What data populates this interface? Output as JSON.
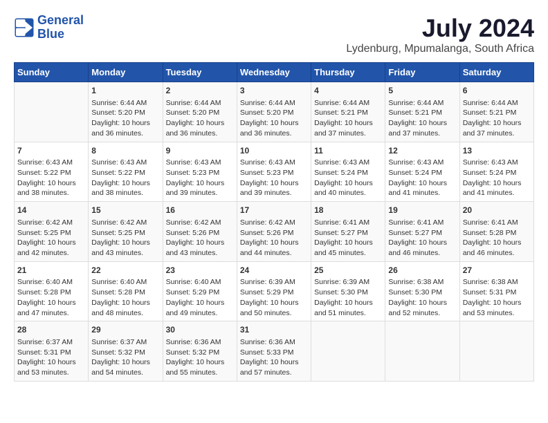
{
  "header": {
    "logo_line1": "General",
    "logo_line2": "Blue",
    "title": "July 2024",
    "subtitle": "Lydenburg, Mpumalanga, South Africa"
  },
  "columns": [
    "Sunday",
    "Monday",
    "Tuesday",
    "Wednesday",
    "Thursday",
    "Friday",
    "Saturday"
  ],
  "weeks": [
    [
      {
        "day": "",
        "info": ""
      },
      {
        "day": "1",
        "info": "Sunrise: 6:44 AM\nSunset: 5:20 PM\nDaylight: 10 hours\nand 36 minutes."
      },
      {
        "day": "2",
        "info": "Sunrise: 6:44 AM\nSunset: 5:20 PM\nDaylight: 10 hours\nand 36 minutes."
      },
      {
        "day": "3",
        "info": "Sunrise: 6:44 AM\nSunset: 5:20 PM\nDaylight: 10 hours\nand 36 minutes."
      },
      {
        "day": "4",
        "info": "Sunrise: 6:44 AM\nSunset: 5:21 PM\nDaylight: 10 hours\nand 37 minutes."
      },
      {
        "day": "5",
        "info": "Sunrise: 6:44 AM\nSunset: 5:21 PM\nDaylight: 10 hours\nand 37 minutes."
      },
      {
        "day": "6",
        "info": "Sunrise: 6:44 AM\nSunset: 5:21 PM\nDaylight: 10 hours\nand 37 minutes."
      }
    ],
    [
      {
        "day": "7",
        "info": "Sunrise: 6:43 AM\nSunset: 5:22 PM\nDaylight: 10 hours\nand 38 minutes."
      },
      {
        "day": "8",
        "info": "Sunrise: 6:43 AM\nSunset: 5:22 PM\nDaylight: 10 hours\nand 38 minutes."
      },
      {
        "day": "9",
        "info": "Sunrise: 6:43 AM\nSunset: 5:23 PM\nDaylight: 10 hours\nand 39 minutes."
      },
      {
        "day": "10",
        "info": "Sunrise: 6:43 AM\nSunset: 5:23 PM\nDaylight: 10 hours\nand 39 minutes."
      },
      {
        "day": "11",
        "info": "Sunrise: 6:43 AM\nSunset: 5:24 PM\nDaylight: 10 hours\nand 40 minutes."
      },
      {
        "day": "12",
        "info": "Sunrise: 6:43 AM\nSunset: 5:24 PM\nDaylight: 10 hours\nand 41 minutes."
      },
      {
        "day": "13",
        "info": "Sunrise: 6:43 AM\nSunset: 5:24 PM\nDaylight: 10 hours\nand 41 minutes."
      }
    ],
    [
      {
        "day": "14",
        "info": "Sunrise: 6:42 AM\nSunset: 5:25 PM\nDaylight: 10 hours\nand 42 minutes."
      },
      {
        "day": "15",
        "info": "Sunrise: 6:42 AM\nSunset: 5:25 PM\nDaylight: 10 hours\nand 43 minutes."
      },
      {
        "day": "16",
        "info": "Sunrise: 6:42 AM\nSunset: 5:26 PM\nDaylight: 10 hours\nand 43 minutes."
      },
      {
        "day": "17",
        "info": "Sunrise: 6:42 AM\nSunset: 5:26 PM\nDaylight: 10 hours\nand 44 minutes."
      },
      {
        "day": "18",
        "info": "Sunrise: 6:41 AM\nSunset: 5:27 PM\nDaylight: 10 hours\nand 45 minutes."
      },
      {
        "day": "19",
        "info": "Sunrise: 6:41 AM\nSunset: 5:27 PM\nDaylight: 10 hours\nand 46 minutes."
      },
      {
        "day": "20",
        "info": "Sunrise: 6:41 AM\nSunset: 5:28 PM\nDaylight: 10 hours\nand 46 minutes."
      }
    ],
    [
      {
        "day": "21",
        "info": "Sunrise: 6:40 AM\nSunset: 5:28 PM\nDaylight: 10 hours\nand 47 minutes."
      },
      {
        "day": "22",
        "info": "Sunrise: 6:40 AM\nSunset: 5:28 PM\nDaylight: 10 hours\nand 48 minutes."
      },
      {
        "day": "23",
        "info": "Sunrise: 6:40 AM\nSunset: 5:29 PM\nDaylight: 10 hours\nand 49 minutes."
      },
      {
        "day": "24",
        "info": "Sunrise: 6:39 AM\nSunset: 5:29 PM\nDaylight: 10 hours\nand 50 minutes."
      },
      {
        "day": "25",
        "info": "Sunrise: 6:39 AM\nSunset: 5:30 PM\nDaylight: 10 hours\nand 51 minutes."
      },
      {
        "day": "26",
        "info": "Sunrise: 6:38 AM\nSunset: 5:30 PM\nDaylight: 10 hours\nand 52 minutes."
      },
      {
        "day": "27",
        "info": "Sunrise: 6:38 AM\nSunset: 5:31 PM\nDaylight: 10 hours\nand 53 minutes."
      }
    ],
    [
      {
        "day": "28",
        "info": "Sunrise: 6:37 AM\nSunset: 5:31 PM\nDaylight: 10 hours\nand 53 minutes."
      },
      {
        "day": "29",
        "info": "Sunrise: 6:37 AM\nSunset: 5:32 PM\nDaylight: 10 hours\nand 54 minutes."
      },
      {
        "day": "30",
        "info": "Sunrise: 6:36 AM\nSunset: 5:32 PM\nDaylight: 10 hours\nand 55 minutes."
      },
      {
        "day": "31",
        "info": "Sunrise: 6:36 AM\nSunset: 5:33 PM\nDaylight: 10 hours\nand 57 minutes."
      },
      {
        "day": "",
        "info": ""
      },
      {
        "day": "",
        "info": ""
      },
      {
        "day": "",
        "info": ""
      }
    ]
  ]
}
